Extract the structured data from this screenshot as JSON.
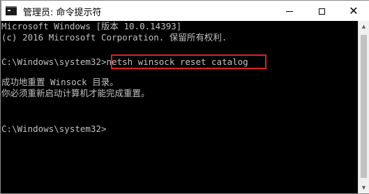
{
  "window": {
    "title": "管理员: 命令提示符",
    "app_icon": "console-icon"
  },
  "controls": {
    "minimize": "minimize-icon",
    "maximize": "maximize-icon",
    "close": "close-icon",
    "close_glyph": "✕"
  },
  "console": {
    "lines": [
      "Microsoft Windows [版本 10.0.14393]",
      "(c) 2016 Microsoft Corporation. 保留所有权利.",
      "",
      "C:\\Windows\\system32>netsh winsock reset catalog",
      "",
      "成功地重置 Winsock 目录。",
      "你必须重新启动计算机才能完成重置。",
      "",
      "",
      "C:\\Windows\\system32>"
    ],
    "highlight_color": "#e02020",
    "text_color": "#c0c0c0",
    "background_color": "#000000"
  },
  "scrollbar": {
    "up_glyph": "▲",
    "down_glyph": "▼"
  }
}
